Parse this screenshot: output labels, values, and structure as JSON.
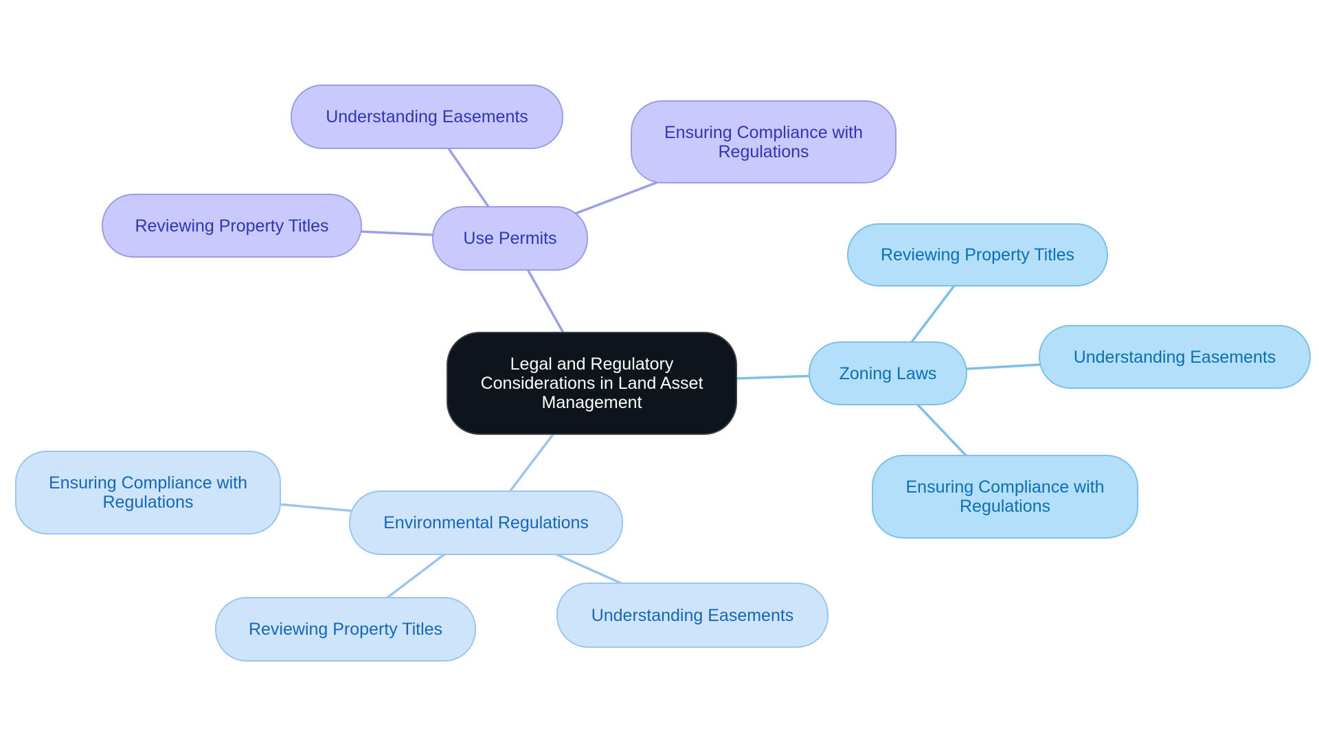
{
  "mindmap": {
    "root": {
      "id": "root",
      "label": "Legal and Regulatory Considerations in Land Asset Management"
    },
    "branches": [
      {
        "id": "use-permits",
        "label": "Use Permits",
        "theme": "purple",
        "edge_color": "#9da0e6",
        "children": [
          {
            "id": "up-easements",
            "label": "Understanding Easements"
          },
          {
            "id": "up-compliance",
            "label": "Ensuring Compliance with Regulations"
          },
          {
            "id": "up-titles",
            "label": "Reviewing Property Titles"
          }
        ]
      },
      {
        "id": "zoning-laws",
        "label": "Zoning Laws",
        "theme": "sky",
        "edge_color": "#7cbfe7",
        "children": [
          {
            "id": "zl-titles",
            "label": "Reviewing Property Titles"
          },
          {
            "id": "zl-easements",
            "label": "Understanding Easements"
          },
          {
            "id": "zl-compliance",
            "label": "Ensuring Compliance with Regulations"
          }
        ]
      },
      {
        "id": "environmental-regulations",
        "label": "Environmental Regulations",
        "theme": "pale",
        "edge_color": "#9cc5ee",
        "children": [
          {
            "id": "er-compliance",
            "label": "Ensuring Compliance with Regulations"
          },
          {
            "id": "er-titles",
            "label": "Reviewing Property Titles"
          },
          {
            "id": "er-easements",
            "label": "Understanding Easements"
          }
        ]
      }
    ]
  },
  "colors": {
    "root_bg": "#0d141b",
    "purple_bg": "#c8c9fc",
    "purple_text": "#3135b4",
    "sky_bg": "#b3dffb",
    "sky_text": "#0c6fb2",
    "pale_bg": "#cde4fb",
    "pale_text": "#1667b8"
  }
}
